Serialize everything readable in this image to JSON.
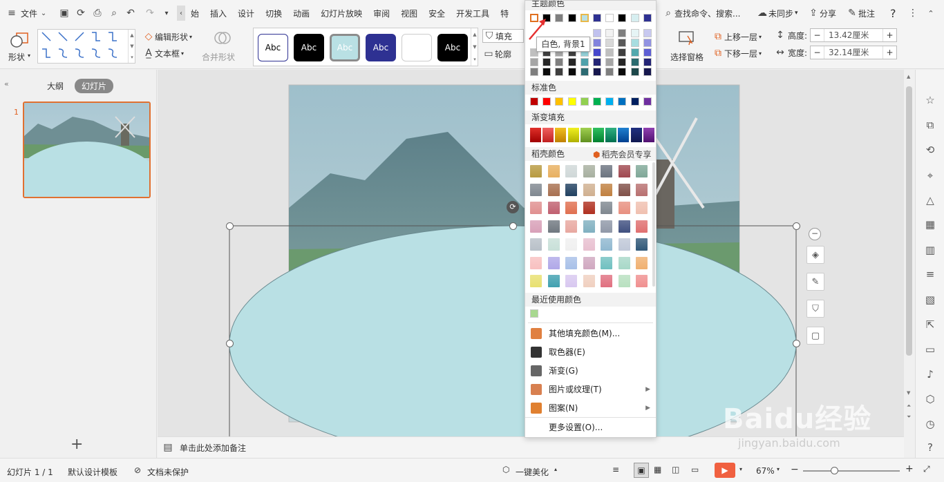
{
  "menu": {
    "file": "文件",
    "tabs": [
      "始",
      "插入",
      "设计",
      "切换",
      "动画",
      "幻灯片放映",
      "审阅",
      "视图",
      "安全",
      "开发工具",
      "特"
    ],
    "search": "查找命令、搜索...",
    "sync": "未同步",
    "share": "分享",
    "comment": "批注",
    "help": "?"
  },
  "ribbon": {
    "shape": "形状",
    "edit_shape": "编辑形状",
    "textbox": "文本框",
    "merge_shape": "合并形状",
    "style_boxes": [
      {
        "label": "Abc",
        "bg": "#ffffff",
        "fg": "#000000",
        "border": "#2e3192"
      },
      {
        "label": "Abc",
        "bg": "#000000",
        "fg": "#ffffff",
        "border": "#000000"
      },
      {
        "label": "Abc",
        "bg": "#b9e0e4",
        "fg": "#ffffff",
        "border": "#8c8c8c"
      },
      {
        "label": "Abc",
        "bg": "#2e3192",
        "fg": "#ffffff",
        "border": "#2e3192"
      },
      {
        "label": "",
        "bg": "#ffffff",
        "fg": "#000000",
        "border": "#cccccc"
      },
      {
        "label": "Abc",
        "bg": "#000000",
        "fg": "#ffffff",
        "border": "#000000"
      }
    ],
    "fill": "填充",
    "outline": "轮廓",
    "select_pane": "选择窗格",
    "bring_forward": "上移一层",
    "send_backward": "下移一层",
    "height_label": "高度:",
    "height_value": "13.42厘米",
    "width_label": "宽度:",
    "width_value": "32.14厘米",
    "minus": "−",
    "plus": "+"
  },
  "left_panel": {
    "outline_tab": "大纲",
    "slides_tab": "幻灯片",
    "slide_number": "1",
    "add": "+"
  },
  "color_panel": {
    "theme_title": "主题颜色",
    "tooltip": "白色, 背景1",
    "standard_title": "标准色",
    "gradient_title": "渐变填充",
    "docer_title": "稻壳颜色",
    "member_label": "稻壳会员专享",
    "recent_title": "最近使用颜色",
    "theme_top": [
      "#ffffff",
      "#000000",
      "#7f7f7f",
      "#000000",
      "#b9e0e4",
      "#2e3192",
      "#ffffff",
      "#000000",
      "#d6eef0",
      "#2e3192"
    ],
    "theme_shades": [
      [
        "#f2f2f2",
        "#7f7f7f",
        "#d9d9d9",
        "#7f7f7f",
        "#e3f3f5",
        "#c0c1ee",
        "#f2f2f2",
        "#7f7f7f",
        "#e6f4f5",
        "#c8c9f0"
      ],
      [
        "#d8d8d8",
        "#595959",
        "#bfbfbf",
        "#595959",
        "#c8e8ec",
        "#8283dd",
        "#d8d8d8",
        "#595959",
        "#a8dde0",
        "#9293e2"
      ],
      [
        "#bfbfbf",
        "#3f3f3f",
        "#a5a5a5",
        "#3f3f3f",
        "#93cfd6",
        "#4546cc",
        "#bfbfbf",
        "#3f3f3f",
        "#52a8ad",
        "#5e5fd4"
      ],
      [
        "#a5a5a5",
        "#262626",
        "#7f7f7f",
        "#262626",
        "#4fa1ab",
        "#232475",
        "#a5a5a5",
        "#262626",
        "#2a6a6e",
        "#232475"
      ],
      [
        "#7f7f7f",
        "#0c0c0c",
        "#3f3f3f",
        "#0c0c0c",
        "#2d6b73",
        "#17184e",
        "#7f7f7f",
        "#0c0c0c",
        "#1c474a",
        "#17184e"
      ]
    ],
    "standard": [
      "#c00000",
      "#ff0000",
      "#ffc000",
      "#ffff00",
      "#92d050",
      "#00b050",
      "#00b0f0",
      "#0070c0",
      "#002060",
      "#7030a0"
    ],
    "gradients": [
      [
        "#e0302a",
        "#a00000"
      ],
      [
        "#f06060",
        "#c02020"
      ],
      [
        "#f0c020",
        "#c08000"
      ],
      [
        "#f0f020",
        "#b0b000"
      ],
      [
        "#a0d050",
        "#609020"
      ],
      [
        "#30c060",
        "#008030"
      ],
      [
        "#30b080",
        "#007050"
      ],
      [
        "#2080d0",
        "#004090"
      ],
      [
        "#203080",
        "#101850"
      ],
      [
        "#9040b0",
        "#501070"
      ]
    ],
    "docer": [
      [
        "#b89a40",
        "#e8b060",
        "#d0d8d8",
        "#a8b0a0",
        "#6c7480",
        "#a04850",
        "#80a898"
      ],
      [
        "#808890",
        "#a87050",
        "#204060",
        "#d0b090",
        "#c08040",
        "#805048",
        "#b87070"
      ],
      [
        "#e09090",
        "#c06070",
        "#e07050",
        "#b03020",
        "#808890",
        "#e89080",
        "#f0c0b0"
      ],
      [
        "#d8a0b8",
        "#707880",
        "#e8a8a0",
        "#80b0c0",
        "#9098a8",
        "#405080",
        "#e07070"
      ],
      [
        "#b8c0c8",
        "#c8e0d8",
        "#f0f0f0",
        "#e8c0d0",
        "#90b8d0",
        "#c0c8d8",
        "#305878"
      ],
      [
        "#f8c0c0",
        "#b0a8e8",
        "#a8c0e8",
        "#d0a8c0",
        "#70c0c0",
        "#a8d8c8",
        "#f0b070"
      ],
      [
        "#e8e070",
        "#40a0b0",
        "#d8c8f0",
        "#f0d0c0",
        "#e07080",
        "#b8e0c0",
        "#f09090"
      ]
    ],
    "recent": [
      "#a8d890"
    ],
    "items": [
      {
        "label": "其他填充颜色(M)...",
        "icon": "#e08040",
        "arrow": ""
      },
      {
        "label": "取色器(E)",
        "icon": "#333333",
        "arrow": ""
      },
      {
        "label": "渐变(G)",
        "icon": "#666666",
        "arrow": ""
      },
      {
        "label": "图片或纹理(T)",
        "icon": "#d88050",
        "arrow": "▶"
      },
      {
        "label": "图案(N)",
        "icon": "#e08030",
        "arrow": "▶"
      },
      {
        "label": "更多设置(O)...",
        "icon": "",
        "arrow": ""
      }
    ]
  },
  "notes": {
    "placeholder": "单击此处添加备注"
  },
  "status": {
    "slide_info": "幻灯片 1 / 1",
    "template": "默认设计模板",
    "protect": "文档未保护",
    "beautify": "一键美化",
    "zoom": "67%"
  },
  "colors": {
    "ellipse": "#b9e0e4",
    "accent": "#e06020",
    "play": "#f06040"
  },
  "watermark": {
    "brand": "Baidu经验",
    "url": "jingyan.baidu.com"
  }
}
